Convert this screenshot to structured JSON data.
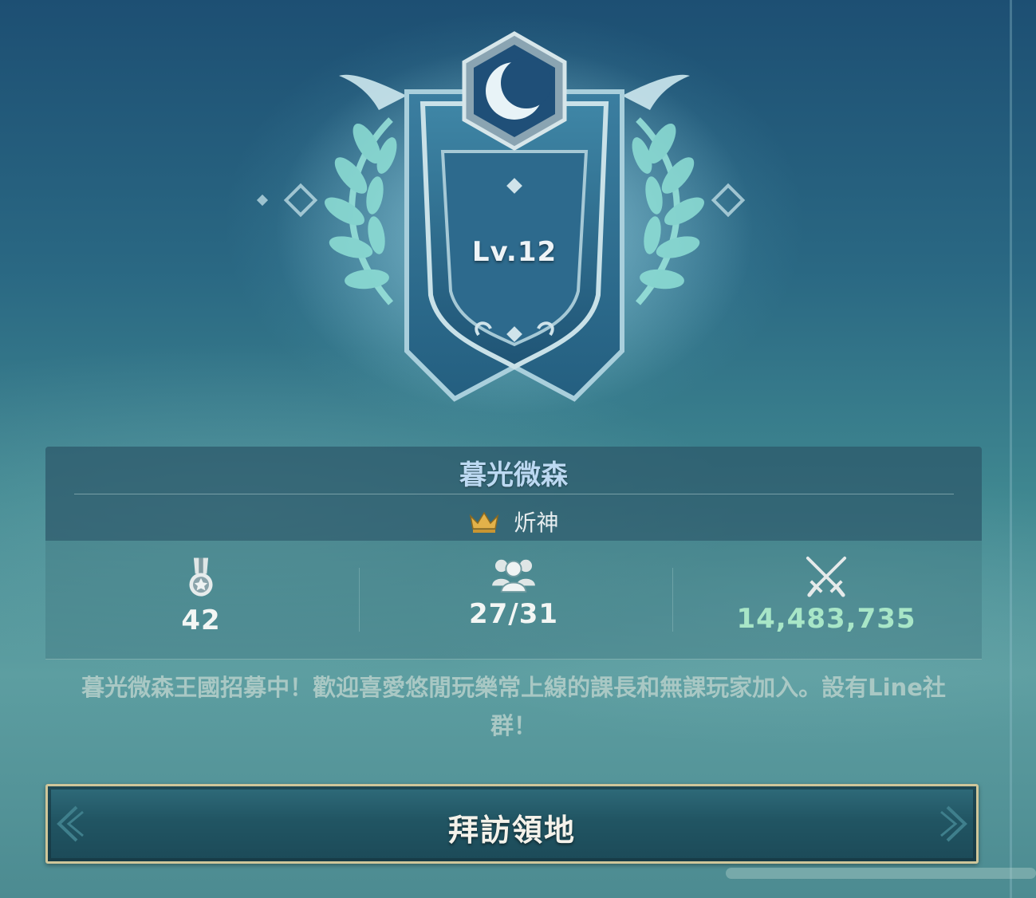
{
  "guild": {
    "level": "Lv.12",
    "name": "暮光微森",
    "leader": "炘神"
  },
  "stats": {
    "rank": "42",
    "members": "27/31",
    "power": "14,483,735"
  },
  "description": {
    "line1": "暮光微森王國招募中！歡迎喜愛悠閒玩樂常上線的課長和無課玩家加入。設有Line社",
    "line2": "群！"
  },
  "actions": {
    "visit_label": "拜訪領地"
  },
  "icons": {
    "emblem": "crescent-moon-emblem-icon",
    "leader": "crown-icon",
    "rank": "medal-icon",
    "members": "members-group-icon",
    "power": "crossed-swords-icon"
  },
  "colors": {
    "guild_name": "#bcd9f2",
    "power_value": "#a8e6c7",
    "button_border": "#cfc69a",
    "crown": "#e2b24a"
  }
}
